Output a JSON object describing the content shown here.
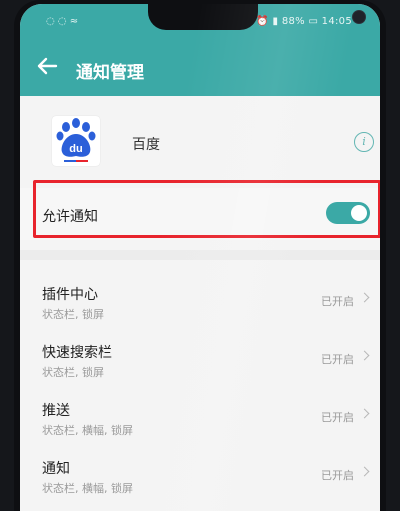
{
  "status_bar": {
    "left": "◌ ◌ ≈",
    "right": "⏰ ▮ 88% ▭ 14:05"
  },
  "header": {
    "title": "通知管理",
    "back_icon": "back-arrow-icon"
  },
  "app": {
    "name": "百度",
    "icon": "baidu-du-logo",
    "info_icon": "info-icon"
  },
  "allow_notification": {
    "label": "允许通知",
    "enabled": true
  },
  "items": [
    {
      "title": "插件中心",
      "subtitle": "状态栏, 锁屏",
      "status": "已开启"
    },
    {
      "title": "快速搜索栏",
      "subtitle": "状态栏, 锁屏",
      "status": "已开启"
    },
    {
      "title": "推送",
      "subtitle": "状态栏, 横幅, 锁屏",
      "status": "已开启"
    },
    {
      "title": "通知",
      "subtitle": "状态栏, 横幅, 锁屏",
      "status": "已开启"
    }
  ],
  "colors": {
    "accent": "#3ba9a6",
    "highlight": "#e8242d"
  }
}
